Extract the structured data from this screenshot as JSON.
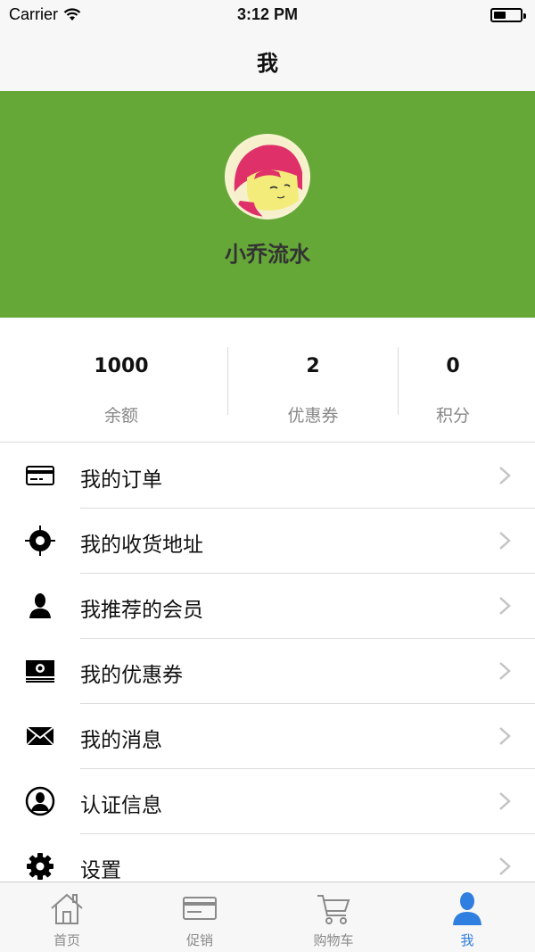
{
  "status_bar": {
    "carrier": "Carrier",
    "time": "3:12 PM",
    "battery_level": 0.45
  },
  "nav": {
    "title": "我"
  },
  "profile": {
    "username": "小乔流水",
    "background_color": "#65a838"
  },
  "stats": [
    {
      "value": "1000",
      "label": "余额"
    },
    {
      "value": "2",
      "label": "优惠券"
    },
    {
      "value": "0",
      "label": "积分"
    }
  ],
  "menu": [
    {
      "label": "我的订单",
      "icon": "credit-card-icon"
    },
    {
      "label": "我的收货地址",
      "icon": "location-target-icon"
    },
    {
      "label": "我推荐的会员",
      "icon": "person-icon"
    },
    {
      "label": "我的优惠券",
      "icon": "banknote-icon"
    },
    {
      "label": "我的消息",
      "icon": "envelope-icon"
    },
    {
      "label": "认证信息",
      "icon": "user-circle-icon"
    },
    {
      "label": "设置",
      "icon": "gear-icon"
    }
  ],
  "tabs": [
    {
      "label": "首页",
      "icon": "home-icon",
      "active": false
    },
    {
      "label": "促销",
      "icon": "card-icon",
      "active": false
    },
    {
      "label": "购物车",
      "icon": "cart-icon",
      "active": false
    },
    {
      "label": "我",
      "icon": "person-icon",
      "active": true
    }
  ],
  "colors": {
    "accent": "#2f7fe0",
    "profile_green": "#65a838"
  }
}
